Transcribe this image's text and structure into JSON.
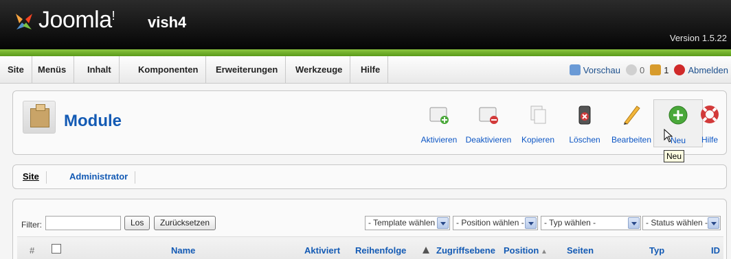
{
  "header": {
    "logo_text": "Joomla",
    "logo_bang": "!",
    "site_name": "vish4",
    "version": "Version 1.5.22"
  },
  "menu": {
    "items": [
      "Site",
      "Menüs",
      "Inhalt",
      "Komponenten",
      "Erweiterungen",
      "Werkzeuge",
      "Hilfe"
    ],
    "preview": "Vorschau",
    "messages_count": "0",
    "users_count": "1",
    "logout": "Abmelden"
  },
  "toolbar": {
    "title": "Module",
    "buttons": [
      "Aktivieren",
      "Deaktivieren",
      "Kopieren",
      "Löschen",
      "Bearbeiten",
      "Neu",
      "Hilfe"
    ],
    "tooltip": "Neu"
  },
  "submenu": {
    "items": [
      "Site",
      "Administrator"
    ]
  },
  "filter": {
    "label": "Filter:",
    "value": "",
    "go": "Los",
    "reset": "Zurücksetzen",
    "template": "- Template wählen -",
    "position": "- Position wählen -",
    "type": "- Typ wählen -",
    "status": "- Status wählen -"
  },
  "table": {
    "columns": [
      "#",
      "Name",
      "Aktiviert",
      "Reihenfolge",
      "Zugriffsebene",
      "Position",
      "Seiten",
      "Typ",
      "ID"
    ]
  },
  "colors": {
    "accent_blue": "#135ab4",
    "green_bar": "#8cc63f"
  }
}
